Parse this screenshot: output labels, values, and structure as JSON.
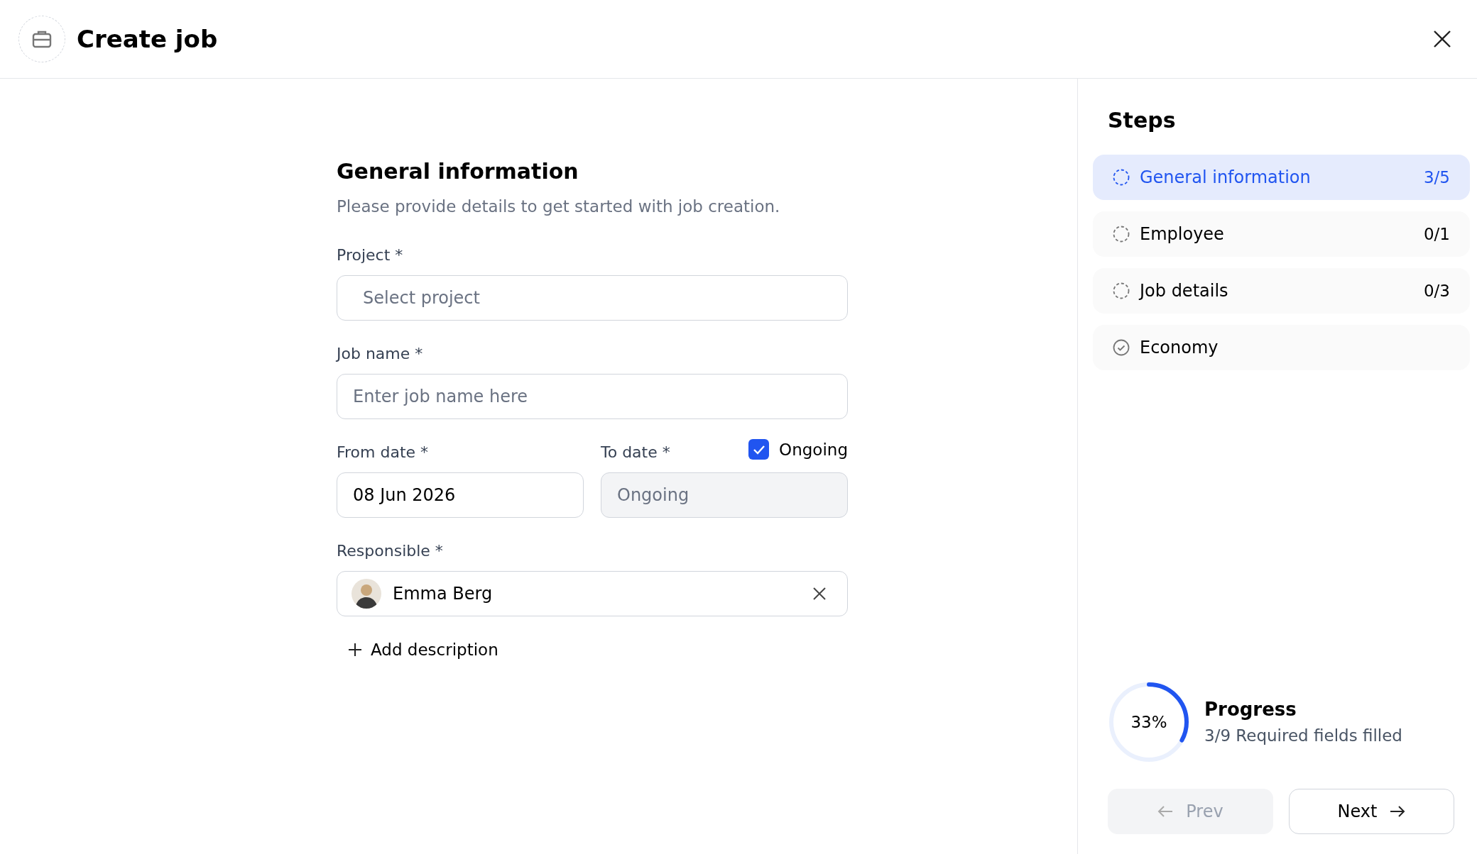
{
  "header": {
    "title": "Create job"
  },
  "form": {
    "title": "General information",
    "subtitle": "Please provide details to get started with job creation.",
    "project": {
      "label": "Project *",
      "placeholder": "Select project"
    },
    "job_name": {
      "label": "Job name *",
      "placeholder": "Enter job name here"
    },
    "from_date": {
      "label": "From date *",
      "value": "08 Jun 2026"
    },
    "to_date": {
      "label": "To date *",
      "placeholder": "Ongoing",
      "disabled": true
    },
    "ongoing": {
      "label": "Ongoing",
      "checked": true
    },
    "responsible": {
      "label": "Responsible *",
      "value": "Emma Berg"
    },
    "add_description": "Add description"
  },
  "steps": {
    "title": "Steps",
    "items": [
      {
        "label": "General information",
        "count": "3/5",
        "selected": true,
        "complete": false
      },
      {
        "label": "Employee",
        "count": "0/1",
        "selected": false,
        "complete": false
      },
      {
        "label": "Job details",
        "count": "0/3",
        "selected": false,
        "complete": false
      },
      {
        "label": "Economy",
        "selected": false,
        "complete": true
      }
    ]
  },
  "progress": {
    "level": 0.33,
    "percent": "33%",
    "title": "Progress",
    "caption": "3/9 Required fields filled"
  },
  "buttons": {
    "prev": {
      "label": "Prev",
      "disabled": true
    },
    "next": {
      "label": "Next",
      "disabled": false
    }
  }
}
